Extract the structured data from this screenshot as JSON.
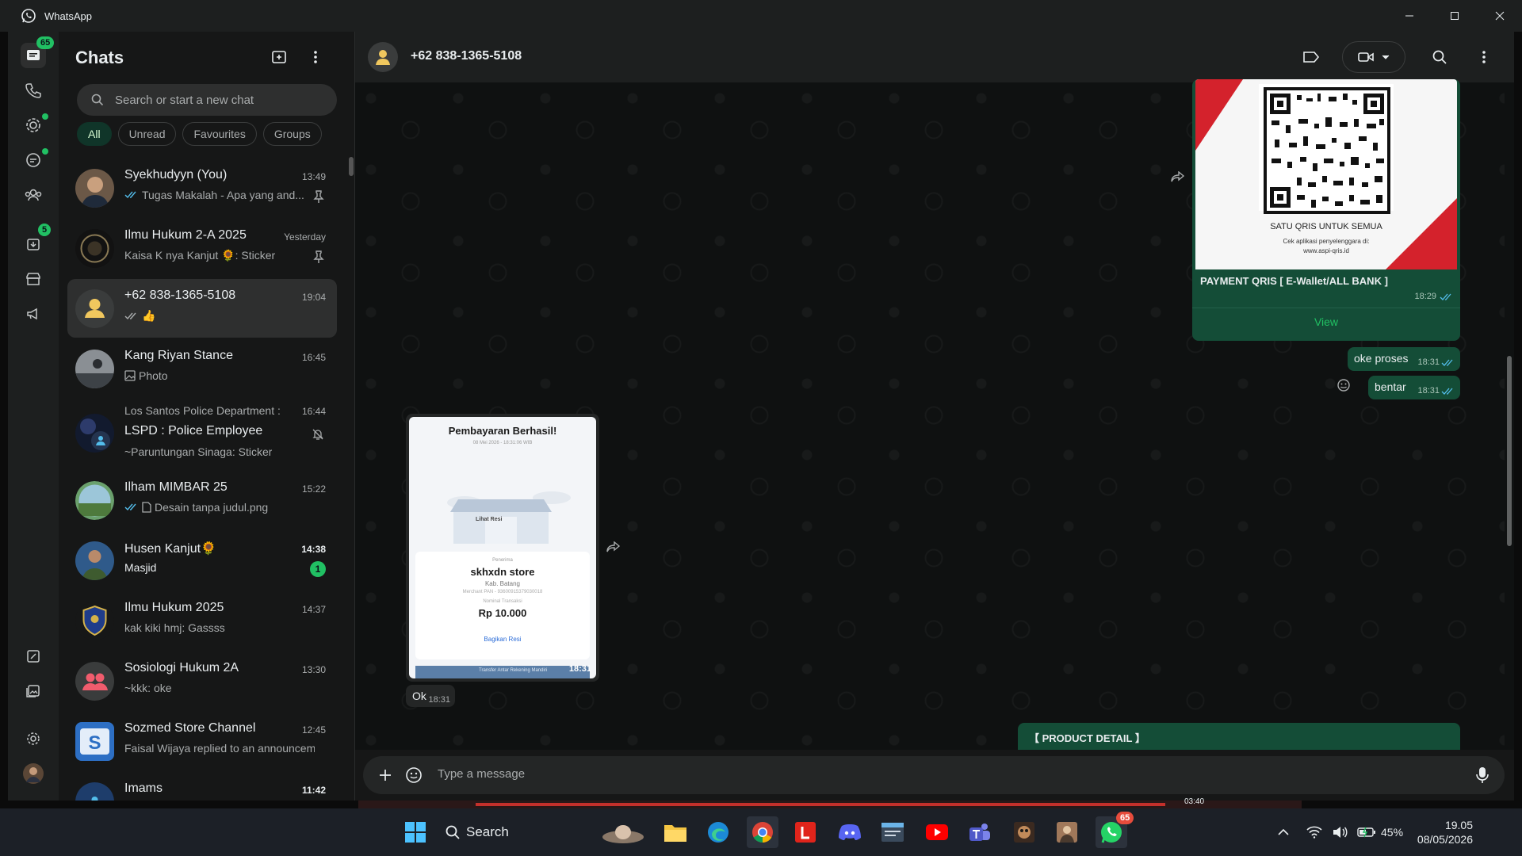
{
  "window": {
    "app_name": "WhatsApp"
  },
  "rail": {
    "chats_badge": "65",
    "updates_badge": "5"
  },
  "chatlist": {
    "title": "Chats",
    "search_placeholder": "Search or start a new chat",
    "filters": [
      "All",
      "Unread",
      "Favourites",
      "Groups"
    ],
    "chats": [
      {
        "name": "Syekhudyyn (You)",
        "time": "13:49",
        "preview": "Tugas Makalah - Apa yang and...",
        "pinned": true
      },
      {
        "name": "Ilmu Hukum 2-A 2025",
        "time": "Yesterday",
        "preview": "Kaisa K nya Kanjut 🌻: Sticker",
        "pinned": true
      },
      {
        "name": "+62 838-1365-5108",
        "time": "19:04",
        "preview": "👍"
      },
      {
        "name": "Kang Riyan Stance",
        "time": "16:45",
        "preview": "Photo"
      },
      {
        "group_line": "Los Santos Police Department : ...",
        "name": "LSPD : Police Employee",
        "time": "16:44",
        "preview": "~Paruntungan Sinaga: Sticker",
        "muted": true
      },
      {
        "name": "Ilham MIMBAR 25",
        "time": "15:22",
        "preview": "Desain tanpa judul.png"
      },
      {
        "name": "Husen Kanjut🌻",
        "time": "14:38",
        "preview": "Masjid",
        "unread": "1"
      },
      {
        "name": "Ilmu Hukum 2025",
        "time": "14:37",
        "preview": "kak kiki hmj: Gassss"
      },
      {
        "name": "Sosiologi Hukum 2A",
        "time": "13:30",
        "preview": "~kkk: oke"
      },
      {
        "name": "Sozmed Store Channel",
        "time": "12:45",
        "preview": "Faisal Wijaya replied to an announceme"
      },
      {
        "name": "Imams",
        "time": "11:42",
        "preview": ""
      }
    ]
  },
  "conversation": {
    "contact": "+62 838-1365-5108",
    "qris": {
      "tagline": "SATU QRIS UNTUK SEMUA",
      "note_line1": "Cek aplikasi penyelenggara di:",
      "note_line2": "www.aspi-qris.id",
      "caption": "PAYMENT QRIS [ E-Wallet/ALL BANK ]",
      "time": "18:29",
      "view_button": "View"
    },
    "msg_oke": {
      "text": "oke proses",
      "time": "18:31"
    },
    "msg_bentar": {
      "text": "bentar",
      "time": "18:31"
    },
    "receipt": {
      "title": "Pembayaran Berhasil!",
      "subtitle": "08 Mei 2026 - 18:31:06 WIB",
      "store_label": "Lihat Resi",
      "recipient_label": "Penerima",
      "store": "skhxdn store",
      "location": "Kab. Batang",
      "merchant": "Merchant PAN - 93600915379030018",
      "amount_label": "Nominal Transaksi",
      "amount": "Rp 10.000",
      "share": "Bagikan Resi",
      "footer": "Transfer Antar Rekening Mandiri",
      "time": "18:31"
    },
    "msg_ok": {
      "text": "Ok",
      "time": "18:31"
    },
    "product_detail": "【 PRODUCT DETAIL 】",
    "composer_placeholder": "Type a message"
  },
  "taskbar": {
    "search_label": "Search",
    "whatsapp_badge": "65",
    "video_time": "03:40",
    "battery": "45%",
    "time": "19.05",
    "date": "08/05/2026"
  },
  "colors": {
    "accent": "#21c063",
    "outgoing_bubble": "#144d37",
    "incoming_bubble": "#242626",
    "panel": "#161717"
  }
}
